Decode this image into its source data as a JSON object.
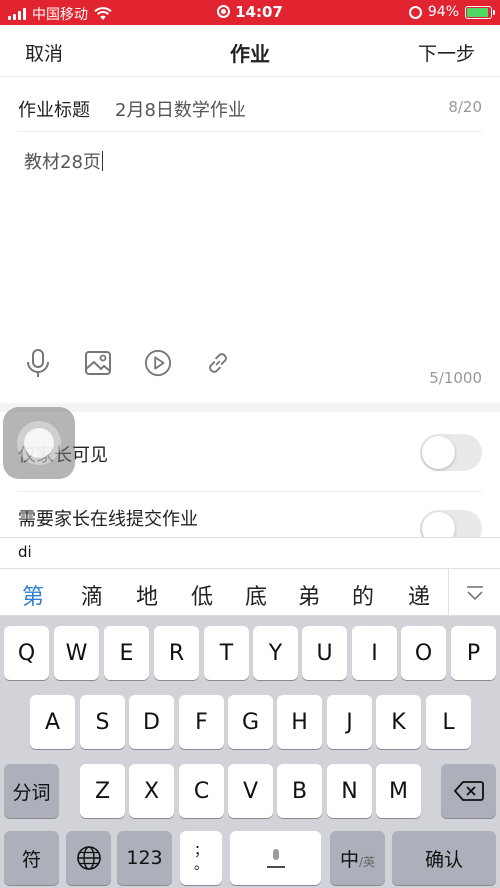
{
  "status_bar": {
    "carrier": "中国移动",
    "time": "14:07",
    "battery_percent": "94%",
    "battery_level": 0.94,
    "icons": [
      "signal-icon",
      "wifi-icon",
      "screen-record-icon",
      "rotation-lock-icon",
      "battery-icon"
    ]
  },
  "nav": {
    "cancel": "取消",
    "title": "作业",
    "next": "下一步"
  },
  "form": {
    "title_label": "作业标题",
    "title_value": "2月8日数学作业",
    "title_count": "8/20",
    "content_value": "教材28页",
    "content_count": "5/1000",
    "tools": [
      "microphone-icon",
      "image-icon",
      "play-video-icon",
      "link-icon"
    ]
  },
  "settings": [
    {
      "label": "仅家长可见",
      "enabled": false
    },
    {
      "label": "需要家长在线提交作业",
      "enabled": false
    }
  ],
  "ime": {
    "pinyin": "di",
    "candidates": [
      "第",
      "滴",
      "地",
      "低",
      "底",
      "弟",
      "的",
      "递"
    ],
    "selected_candidate": "第",
    "accent_color": "#2f7fd1"
  },
  "keyboard": {
    "row1": [
      "Q",
      "W",
      "E",
      "R",
      "T",
      "Y",
      "U",
      "I",
      "O",
      "P"
    ],
    "row2": [
      "A",
      "S",
      "D",
      "F",
      "G",
      "H",
      "J",
      "K",
      "L"
    ],
    "row3_left": "分词",
    "row3": [
      "Z",
      "X",
      "C",
      "V",
      "B",
      "N",
      "M"
    ],
    "symbols": "符",
    "numbers": "123",
    "punct": "；\n。",
    "lang_main": "中",
    "lang_sub": "/英",
    "confirm": "确认"
  },
  "colors": {
    "status_bar_bg": "#e1242f",
    "battery_fill": "#4cd964"
  }
}
